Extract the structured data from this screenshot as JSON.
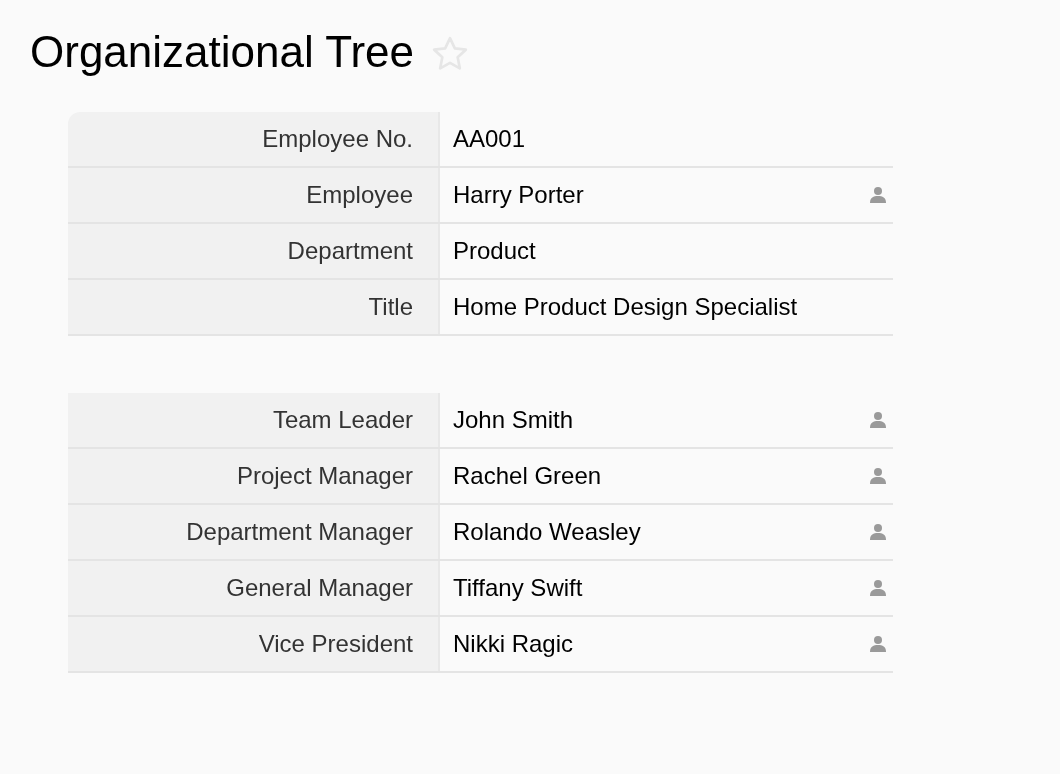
{
  "page": {
    "title": "Organizational Tree",
    "starred": false
  },
  "sections": [
    {
      "fields": [
        {
          "label": "Employee No.",
          "value": "AA001",
          "kind": "text"
        },
        {
          "label": "Employee",
          "value": "Harry Porter",
          "kind": "person"
        },
        {
          "label": "Department",
          "value": "Product",
          "kind": "text"
        },
        {
          "label": "Title",
          "value": "Home Product Design Specialist",
          "kind": "text"
        }
      ]
    },
    {
      "fields": [
        {
          "label": "Team Leader",
          "value": "John Smith",
          "kind": "person"
        },
        {
          "label": "Project Manager",
          "value": "Rachel Green",
          "kind": "person"
        },
        {
          "label": "Department Manager",
          "value": "Rolando Weasley",
          "kind": "person"
        },
        {
          "label": "General Manager",
          "value": "Tiffany Swift",
          "kind": "person"
        },
        {
          "label": "Vice President",
          "value": "Nikki Ragic",
          "kind": "person"
        }
      ]
    }
  ]
}
